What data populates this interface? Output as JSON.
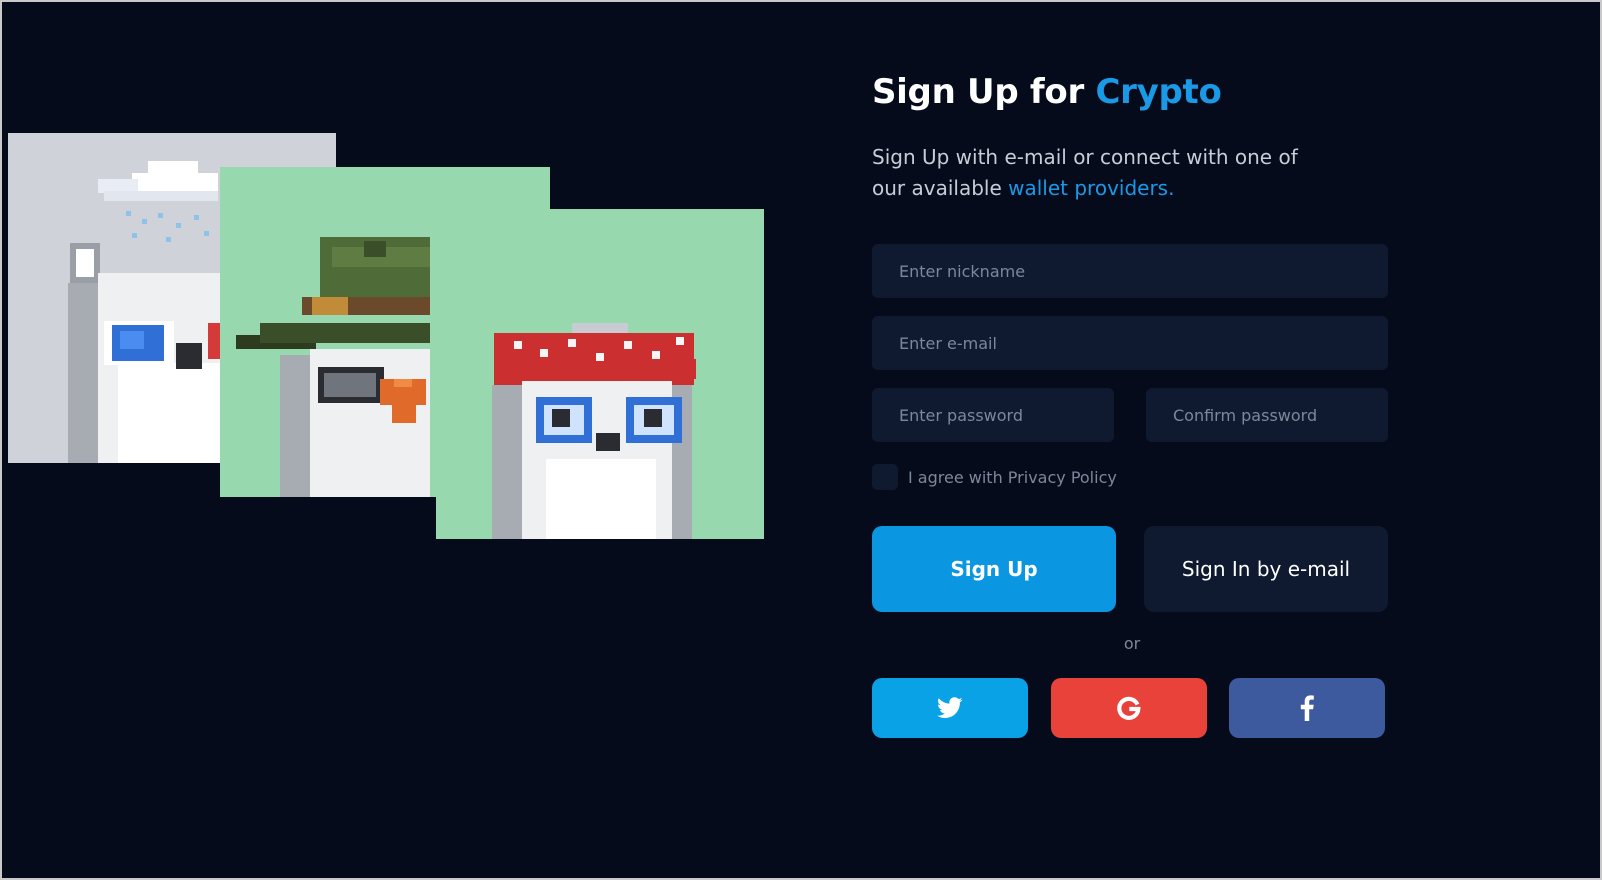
{
  "heading": {
    "prefix": "Sign Up for",
    "accent": "Crypto"
  },
  "subtitle": {
    "text": "Sign Up with e-mail or connect with one of our available",
    "link": "wallet providers."
  },
  "form": {
    "nickname_placeholder": "Enter nickname",
    "email_placeholder": "Enter e-mail",
    "password_placeholder": "Enter password",
    "confirm_placeholder": "Confirm password",
    "agree_label": "I agree with Privacy Policy"
  },
  "buttons": {
    "signup_label": "Sign Up",
    "signin_label": "Sign In by e-mail",
    "or_label": "or"
  },
  "social": [
    {
      "name": "twitter",
      "icon": "twitter-icon",
      "color": "#0aa2e6"
    },
    {
      "name": "google",
      "icon": "google-icon",
      "color": "#e8423a"
    },
    {
      "name": "facebook",
      "icon": "facebook-icon",
      "color": "#3d5a9e"
    }
  ],
  "artworks": [
    {
      "name": "snowy-bird",
      "background": "#cfd2d8"
    },
    {
      "name": "ranger-hat-bird",
      "background": "#98d8ae"
    },
    {
      "name": "bandana-bird",
      "background": "#98d8ae"
    }
  ],
  "colors": {
    "background": "#060b1c",
    "accent": "#1a99e6",
    "field": "#0f1a30",
    "primary_button": "#0a96e0"
  }
}
